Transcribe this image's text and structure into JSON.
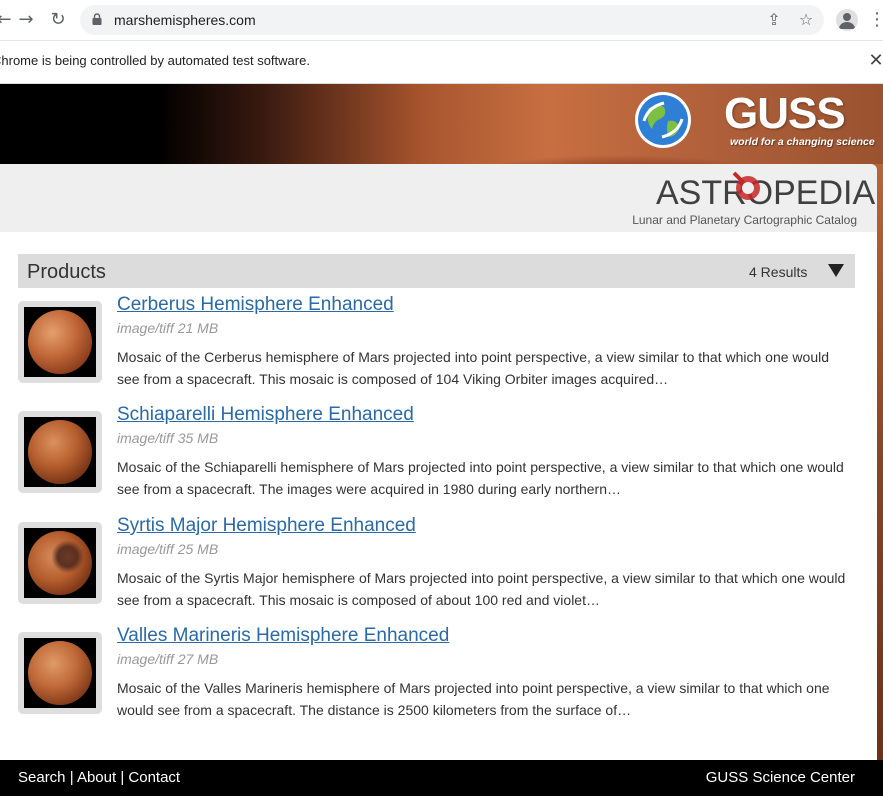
{
  "browser": {
    "url": "marshemispheres.com",
    "infobar_text": "Chrome is being controlled by automated test software.",
    "back_icon": "back-arrow-icon",
    "forward_icon": "forward-arrow-icon",
    "reload_icon": "reload-icon"
  },
  "header": {
    "guss_logo": "GUSS",
    "guss_tagline": "world for a changing science",
    "astropedia_title": "ASTROPEDIA",
    "astropedia_subtitle": "Lunar and Planetary Cartographic Catalog"
  },
  "products": {
    "heading": "Products",
    "results": "4 Results",
    "items": [
      {
        "title": "Cerberus Hemisphere Enhanced",
        "meta": "image/tiff 21 MB",
        "description": "Mosaic of the Cerberus hemisphere of Mars projected into point perspective, a view similar to that which one would see from a spacecraft. This mosaic is composed of 104 Viking Orbiter images acquired…"
      },
      {
        "title": "Schiaparelli Hemisphere Enhanced",
        "meta": "image/tiff 35 MB",
        "description": "Mosaic of the Schiaparelli hemisphere of Mars projected into point perspective, a view similar to that which one would see from a spacecraft. The images were acquired in 1980 during early northern…"
      },
      {
        "title": "Syrtis Major Hemisphere Enhanced",
        "meta": "image/tiff 25 MB",
        "description": "Mosaic of the Syrtis Major hemisphere of Mars projected into point perspective, a view similar to that which one would see from a spacecraft. This mosaic is composed of about 100 red and violet…"
      },
      {
        "title": "Valles Marineris Hemisphere Enhanced",
        "meta": "image/tiff 27 MB",
        "description": "Mosaic of the Valles Marineris hemisphere of Mars projected into point perspective, a view similar to that which one would see from a spacecraft. The distance is 2500 kilometers from the surface of…"
      }
    ]
  },
  "footer": {
    "search": "Search",
    "about": "About",
    "contact": "Contact",
    "separator": "|",
    "right": "GUSS Science Center"
  },
  "colors": {
    "link": "#2a6aa6",
    "products_bar": "#dcdcdc",
    "footer_bg": "#000000"
  }
}
